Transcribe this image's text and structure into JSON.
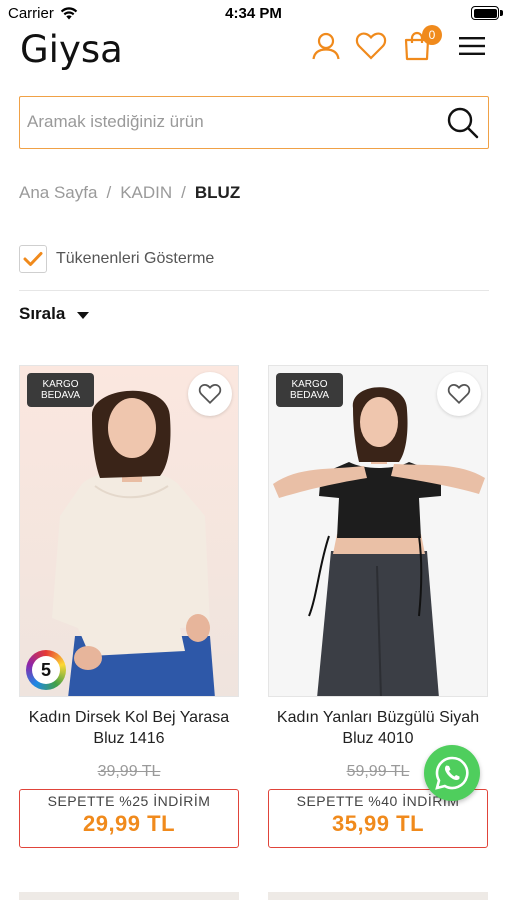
{
  "status_bar": {
    "carrier": "Carrier",
    "time": "4:34 PM"
  },
  "header": {
    "logo": "Giysa",
    "cart_count": "0",
    "accent_color": "#f08a1c"
  },
  "search": {
    "placeholder": "Aramak istediğiniz ürün"
  },
  "breadcrumb": {
    "items": [
      "Ana Sayfa",
      "KADIN",
      "BLUZ"
    ],
    "separator": "/"
  },
  "filter": {
    "label": "Tükenenleri Gösterme",
    "checked": true
  },
  "sort": {
    "label": "Sırala"
  },
  "products": [
    {
      "badge": "KARGO BEDAVA",
      "title": "Kadın Dirsek Kol Bej Yarasa Bluz 1416",
      "old_price": "39,99 TL",
      "promo_label": "SEPETTE %25 İNDİRİM",
      "price": "29,99 TL",
      "corner_badge": "5"
    },
    {
      "badge": "KARGO BEDAVA",
      "title": "Kadın Yanları Büzgülü Siyah Bluz 4010",
      "old_price": "59,99 TL",
      "promo_label": "SEPETTE %40 İNDİRİM",
      "price": "35,99 TL"
    }
  ],
  "icons": [
    "wifi-icon",
    "battery-icon",
    "user-icon",
    "heart-icon",
    "cart-icon",
    "menu-icon",
    "search-icon",
    "check-icon",
    "caret-down-icon",
    "whatsapp-icon"
  ]
}
